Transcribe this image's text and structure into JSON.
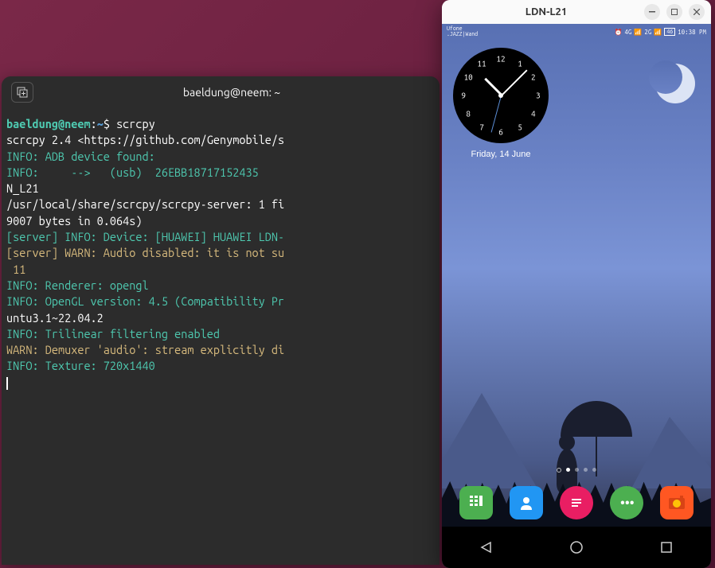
{
  "terminal": {
    "title": "baeldung@neem: ~",
    "prompt": {
      "user": "baeldung@neem",
      "colon": ":",
      "path": "~",
      "dollar": "$"
    },
    "command": "scrcpy",
    "lines": [
      "scrcpy 2.4 <https://github.com/Genymobile/s",
      "INFO: ADB device found:",
      "INFO:     -->   (usb)  26EBB18717152435",
      "N_L21",
      "/usr/local/share/scrcpy/scrcpy-server: 1 fi",
      "9007 bytes in 0.064s)",
      "[server] INFO: Device: [HUAWEI] HUAWEI LDN-",
      "[server] WARN: Audio disabled: it is not su",
      " 11",
      "INFO: Renderer: opengl",
      "INFO: OpenGL version: 4.5 (Compatibility Pr",
      "untu3.1~22.04.2",
      "INFO: Trilinear filtering enabled",
      "WARN: Demuxer 'audio': stream explicitly di",
      "INFO: Texture: 720x1440"
    ]
  },
  "scrcpy": {
    "title": "LDN-L21"
  },
  "phone": {
    "carrier1": "Ufone",
    "carrier2": ".JAZZ|Wand",
    "signal_4g": "4G",
    "signal_2g": "2G",
    "battery": "46",
    "time": "10:38 PM",
    "clock_date": "Friday, 14 June",
    "clock_numbers": [
      "12",
      "1",
      "2",
      "3",
      "4",
      "5",
      "6",
      "7",
      "8",
      "9",
      "10",
      "11"
    ]
  },
  "dock": {
    "dialer": "dialer",
    "contacts": "contacts",
    "messages": "messages",
    "chat": "chat",
    "camera": "camera"
  }
}
